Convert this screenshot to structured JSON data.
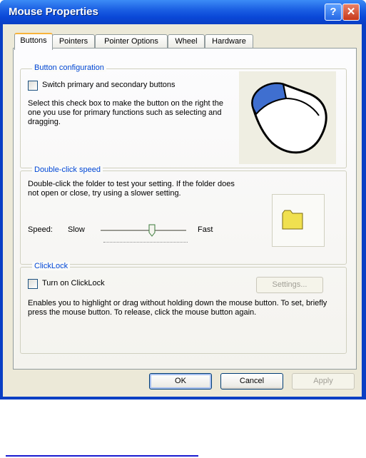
{
  "window": {
    "title": "Mouse Properties",
    "help_glyph": "?",
    "close_glyph": "✕"
  },
  "tabs": [
    {
      "label": "Buttons",
      "active": true
    },
    {
      "label": "Pointers"
    },
    {
      "label": "Pointer Options"
    },
    {
      "label": "Wheel"
    },
    {
      "label": "Hardware"
    }
  ],
  "button_config": {
    "title": "Button configuration",
    "checkbox_label": "Switch primary and secondary buttons",
    "checked": false,
    "description": "Select this check box to make the button on the right the one you use for primary functions such as selecting and dragging."
  },
  "double_click": {
    "title": "Double-click speed",
    "description": "Double-click the folder to test your setting. If the folder does not open or close, try using a slower setting.",
    "speed_label": "Speed:",
    "slow_label": "Slow",
    "fast_label": "Fast",
    "speed_level": 0.6
  },
  "clicklock": {
    "title": "ClickLock",
    "checkbox_label": "Turn on ClickLock",
    "checked": false,
    "settings_label": "Settings...",
    "description": "Enables you to highlight or drag without holding down the mouse button. To set, briefly press the mouse button. To release, click the mouse button again."
  },
  "footer": {
    "ok_label": "OK",
    "cancel_label": "Cancel",
    "apply_label": "Apply"
  },
  "colors": {
    "titlebar": "#0a48d8",
    "accent_tab": "#f8b33b",
    "group_title": "#0046d5",
    "folder": "#f0e050",
    "mouse_button": "#3f6fd0"
  }
}
